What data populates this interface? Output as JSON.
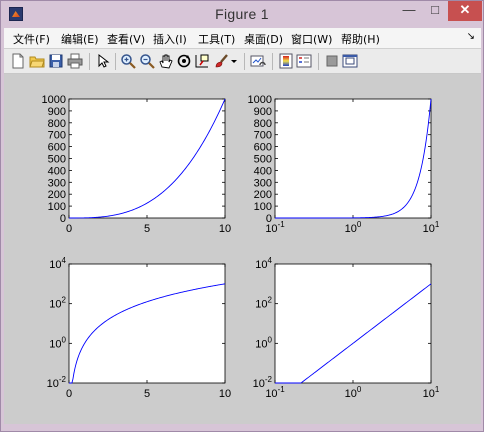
{
  "window": {
    "title": "Figure 1"
  },
  "title_buttons": {
    "minimize": "—",
    "maximize": "□",
    "close": "✕"
  },
  "menu": {
    "items": [
      "文件(F)",
      "编辑(E)",
      "查看(V)",
      "插入(I)",
      "工具(T)",
      "桌面(D)",
      "窗口(W)",
      "帮助(H)"
    ],
    "overflow": "↘"
  },
  "toolbar": {
    "icons": [
      "new-figure-icon",
      "open-file-icon",
      "save-icon",
      "print-icon",
      "pointer-icon",
      "zoom-in-icon",
      "zoom-out-icon",
      "pan-hand-icon",
      "rotate-3d-icon",
      "data-cursor-icon",
      "brush-icon",
      "dropdown-arrow-icon",
      "link-plot-icon",
      "colorbar-icon",
      "legend-icon",
      "hide-plot-tools-icon",
      "show-plot-tools-icon"
    ]
  },
  "colors": {
    "line": "#0000ff",
    "figure_bg": "#cccccc",
    "axes_bg": "#ffffff"
  },
  "chart_data": [
    {
      "type": "line",
      "function": "y = x^3",
      "x": [
        0,
        1,
        2,
        3,
        4,
        5,
        6,
        7,
        8,
        9,
        10
      ],
      "y": [
        0,
        1,
        8,
        27,
        64,
        125,
        216,
        343,
        512,
        729,
        1000
      ],
      "xscale": "linear",
      "yscale": "linear",
      "xlim": [
        0,
        10
      ],
      "ylim": [
        0,
        1000
      ],
      "xticks": [
        "0",
        "5",
        "10"
      ],
      "yticks": [
        "0",
        "100",
        "200",
        "300",
        "400",
        "500",
        "600",
        "700",
        "800",
        "900",
        "1000"
      ],
      "grid": false
    },
    {
      "type": "line",
      "function": "y = x^3",
      "x": [
        0.1,
        1,
        10
      ],
      "y": [
        0.001,
        1,
        1000
      ],
      "xscale": "log",
      "yscale": "linear",
      "xlim": [
        0.1,
        10
      ],
      "ylim": [
        0,
        1000
      ],
      "xticks": [
        {
          "base": "10",
          "exp": "-1"
        },
        {
          "base": "10",
          "exp": "0"
        },
        {
          "base": "10",
          "exp": "1"
        }
      ],
      "yticks": [
        "0",
        "100",
        "200",
        "300",
        "400",
        "500",
        "600",
        "700",
        "800",
        "900",
        "1000"
      ],
      "grid": false
    },
    {
      "type": "line",
      "function": "y = x^3",
      "x": [
        0,
        1,
        2,
        5,
        10
      ],
      "y": [
        0.01,
        1,
        8,
        125,
        1000
      ],
      "xscale": "linear",
      "yscale": "log",
      "xlim": [
        0,
        10
      ],
      "ylim": [
        0.01,
        10000
      ],
      "xticks": [
        "0",
        "5",
        "10"
      ],
      "yticks": [
        {
          "base": "10",
          "exp": "-2"
        },
        {
          "base": "10",
          "exp": "0"
        },
        {
          "base": "10",
          "exp": "2"
        },
        {
          "base": "10",
          "exp": "4"
        }
      ],
      "grid": false
    },
    {
      "type": "line",
      "function": "y = x^3",
      "x": [
        0.1,
        1,
        10
      ],
      "y": [
        0.001,
        1,
        1000
      ],
      "xscale": "log",
      "yscale": "log",
      "xlim": [
        0.1,
        10
      ],
      "ylim": [
        0.01,
        10000
      ],
      "xticks": [
        {
          "base": "10",
          "exp": "-1"
        },
        {
          "base": "10",
          "exp": "0"
        },
        {
          "base": "10",
          "exp": "1"
        }
      ],
      "yticks": [
        {
          "base": "10",
          "exp": "-2"
        },
        {
          "base": "10",
          "exp": "0"
        },
        {
          "base": "10",
          "exp": "2"
        },
        {
          "base": "10",
          "exp": "4"
        }
      ],
      "grid": false
    }
  ]
}
